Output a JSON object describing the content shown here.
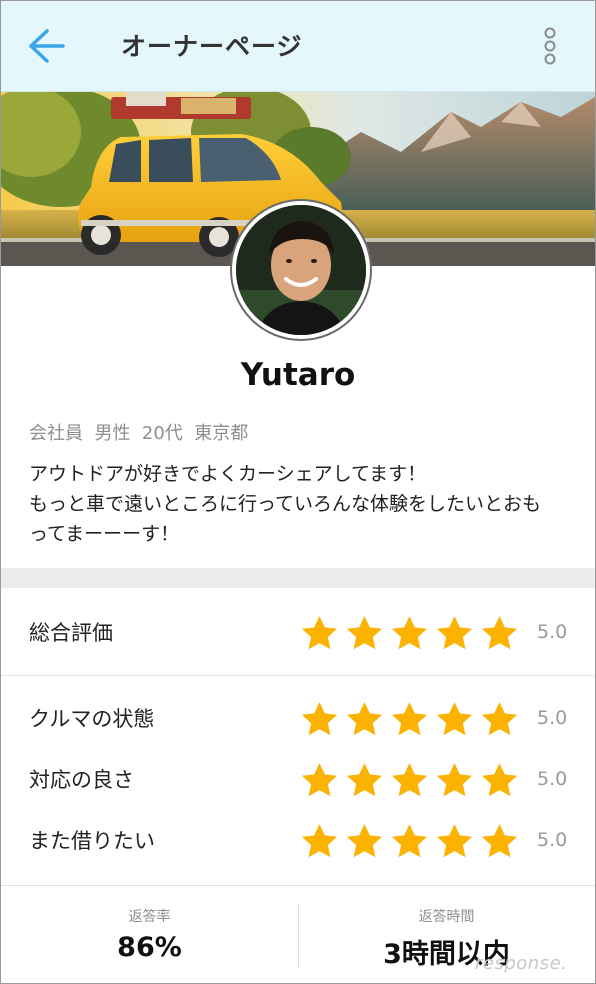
{
  "header": {
    "title": "オーナーページ"
  },
  "colors": {
    "header_bg": "#e4f7fd",
    "accent": "#3aa6e8",
    "star": "#fbb200"
  },
  "icons": {
    "back": "arrow-left-icon",
    "menu": "more-vertical-icon"
  },
  "profile": {
    "name": "Yutaro",
    "meta": "会社員  男性  20代  東京都",
    "bio_lines": [
      "アウトドアが好きでよくカーシェアしてます！",
      "もっと車で遠いところに行っていろんな体験をしたいとおも",
      "ってまーーーす！"
    ]
  },
  "ratings": {
    "overall": {
      "label": "総合評価",
      "score": "5.0",
      "stars": 5
    },
    "items": [
      {
        "label": "クルマの状態",
        "score": "5.0",
        "stars": 5
      },
      {
        "label": "対応の良さ",
        "score": "5.0",
        "stars": 5
      },
      {
        "label": "また借りたい",
        "score": "5.0",
        "stars": 5
      }
    ]
  },
  "stats": [
    {
      "label": "返答率",
      "value": "86%"
    },
    {
      "label": "返答時間",
      "value": "3時間以内"
    }
  ],
  "watermark": "response."
}
